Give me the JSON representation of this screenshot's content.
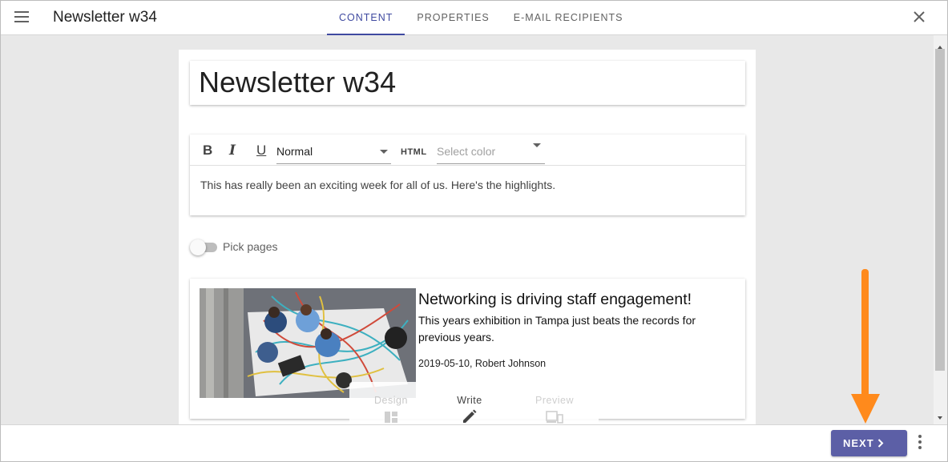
{
  "app": {
    "title": "Newsletter w34",
    "tabs": [
      {
        "label": "CONTENT",
        "active": true
      },
      {
        "label": "PROPERTIES",
        "active": false
      },
      {
        "label": "E-MAIL RECIPIENTS",
        "active": false
      }
    ]
  },
  "editor": {
    "title_value": "Newsletter w34",
    "toolbar": {
      "bold": "B",
      "italic": "I",
      "underline": "U",
      "format_value": "Normal",
      "html_label": "HTML",
      "color_placeholder": "Select color"
    },
    "body_text": "This has really been an exciting week for all of us. Here's the highlights."
  },
  "pick_pages": {
    "label": "Pick pages",
    "enabled": false
  },
  "article": {
    "title": "Networking is driving staff engagement!",
    "description": "This years exhibition in Tampa just beats the records for previous years.",
    "meta": "2019-05-10, Robert Johnson"
  },
  "modes": [
    {
      "label": "Design",
      "icon": "dashboard-icon",
      "active": false
    },
    {
      "label": "Write",
      "icon": "pencil-icon",
      "active": true
    },
    {
      "label": "Preview",
      "icon": "devices-icon",
      "active": false
    }
  ],
  "footer": {
    "next_label": "NEXT"
  },
  "colors": {
    "accent": "#3f4aa0",
    "next_button": "#5c5fa6",
    "annotation_arrow": "#ff8a1c",
    "background": "#e8e8e8"
  }
}
